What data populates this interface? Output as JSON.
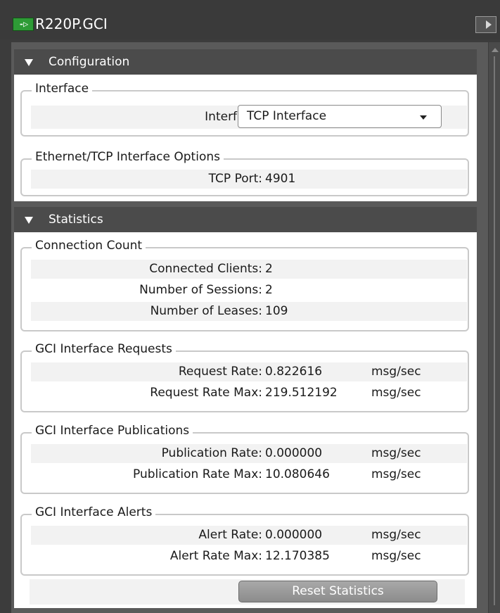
{
  "window": {
    "title": "R220P.GCI",
    "icon": "gci-arrow-icon"
  },
  "configuration": {
    "header": "Configuration",
    "interface_group": {
      "legend": "Interface",
      "field_label": "Interface:",
      "selected": "TCP Interface"
    },
    "ethernet_group": {
      "legend": "Ethernet/TCP Interface Options",
      "port_label": "TCP Port:",
      "port_value": "4901"
    }
  },
  "statistics": {
    "header": "Statistics",
    "connection_count": {
      "legend": "Connection Count",
      "rows": [
        {
          "label": "Connected Clients:",
          "value": "2"
        },
        {
          "label": "Number of Sessions:",
          "value": "2"
        },
        {
          "label": "Number of Leases:",
          "value": "109"
        }
      ]
    },
    "requests": {
      "legend": "GCI Interface Requests",
      "rows": [
        {
          "label": "Request Rate:",
          "value": "0.822616",
          "unit": "msg/sec"
        },
        {
          "label": "Request Rate Max:",
          "value": "219.512192",
          "unit": "msg/sec"
        }
      ]
    },
    "publications": {
      "legend": "GCI Interface Publications",
      "rows": [
        {
          "label": "Publication Rate:",
          "value": "0.000000",
          "unit": "msg/sec"
        },
        {
          "label": "Publication Rate Max:",
          "value": "10.080646",
          "unit": "msg/sec"
        }
      ]
    },
    "alerts": {
      "legend": "GCI Interface Alerts",
      "rows": [
        {
          "label": "Alert Rate:",
          "value": "0.000000",
          "unit": "msg/sec"
        },
        {
          "label": "Alert Rate Max:",
          "value": "12.170385",
          "unit": "msg/sec"
        }
      ]
    },
    "reset_button": "Reset Statistics"
  },
  "colors": {
    "title_bg": "#3a3a3a",
    "section_header_bg": "#4b4b4b",
    "icon_green": "#2e9b36",
    "row_shade": "#f2f2f2"
  }
}
